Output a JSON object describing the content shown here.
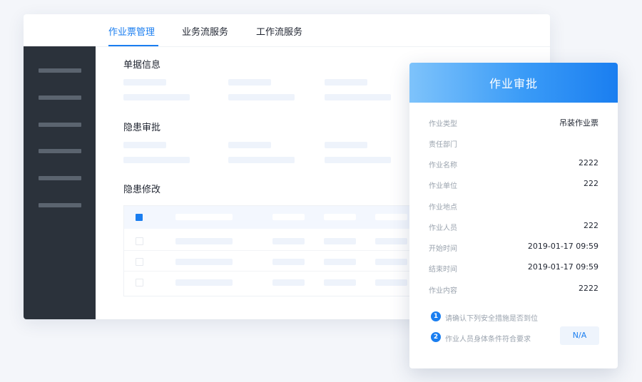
{
  "tabs": [
    {
      "label": "作业票管理",
      "active": true
    },
    {
      "label": "业务流服务",
      "active": false
    },
    {
      "label": "工作流服务",
      "active": false
    }
  ],
  "sections": {
    "doc_info": "单据信息",
    "hazard_approval": "隐患审批",
    "hazard_fix": "隐患修改"
  },
  "panel": {
    "title": "作业审批",
    "fields": [
      {
        "label": "作业类型",
        "value": "吊装作业票"
      },
      {
        "label": "责任部门",
        "value": ""
      },
      {
        "label": "作业名称",
        "value": "2222"
      },
      {
        "label": "作业单位",
        "value": "222"
      },
      {
        "label": "作业地点",
        "value": ""
      },
      {
        "label": "作业人员",
        "value": "222"
      },
      {
        "label": "开始时间",
        "value": "2019-01-17 09:59"
      },
      {
        "label": "结束时间",
        "value": "2019-01-17 09:59"
      },
      {
        "label": "作业内容",
        "value": "2222"
      }
    ],
    "steps": [
      {
        "num": "1",
        "text": "请确认下列安全措施是否到位"
      },
      {
        "num": "2",
        "text": "作业人员身体条件符合要求"
      }
    ],
    "na_button": "N/A"
  },
  "colors": {
    "accent": "#1a7ef0",
    "sidebar": "#2b323b",
    "placeholder": "#eef3fb"
  }
}
